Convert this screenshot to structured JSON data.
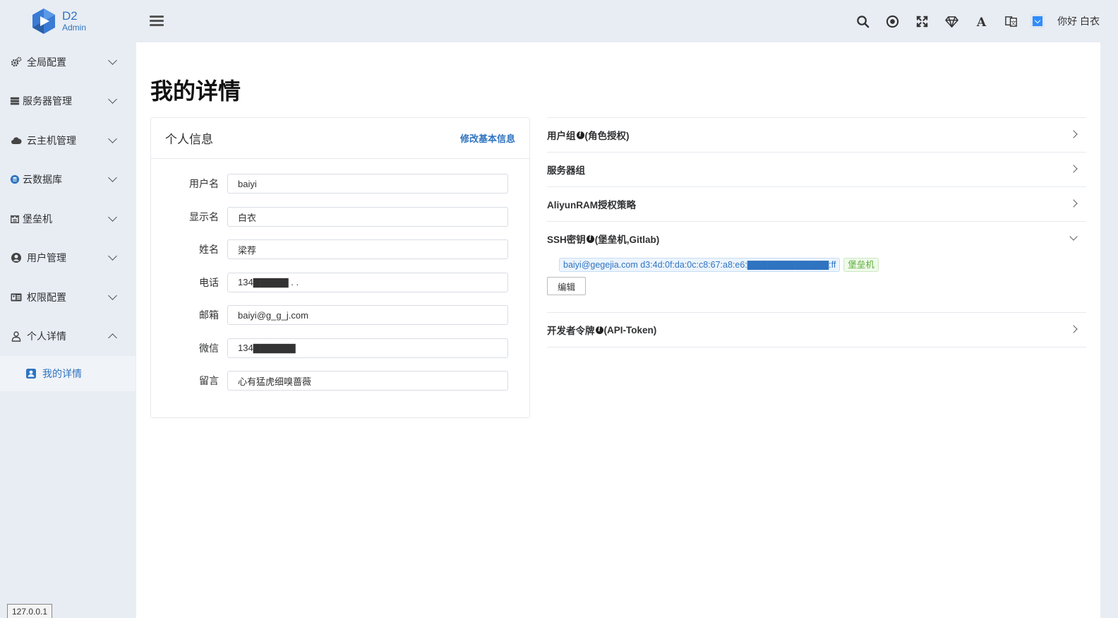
{
  "logo": {
    "title": "D2",
    "subtitle": "Admin"
  },
  "header": {
    "greeting": "你好 白衣",
    "accent": "#2f8cff"
  },
  "sidebar": {
    "items": [
      {
        "label": "全局配置",
        "icon": "gears-icon"
      },
      {
        "label": "服务器管理",
        "icon": "server-icon"
      },
      {
        "label": "云主机管理",
        "icon": "cloud-icon"
      },
      {
        "label": "云数据库",
        "icon": "database-icon"
      },
      {
        "label": "堡垒机",
        "icon": "fortress-icon"
      },
      {
        "label": "用户管理",
        "icon": "user-circle-icon"
      },
      {
        "label": "权限配置",
        "icon": "id-card-icon"
      },
      {
        "label": "个人详情",
        "icon": "user-outline-icon"
      }
    ],
    "sub_active": "我的详情",
    "ip": "127.0.0.1"
  },
  "page": {
    "title": "我的详情"
  },
  "profile": {
    "title": "个人信息",
    "edit_link": "修改基本信息",
    "fields": [
      {
        "label": "用户名",
        "value": "baiyi"
      },
      {
        "label": "显示名",
        "value": "白衣"
      },
      {
        "label": "姓名",
        "value": "梁荐"
      },
      {
        "label": "电话",
        "value": "134▇▇▇▇▇ . ."
      },
      {
        "label": "邮箱",
        "value": "baiyi@g_g_j.com"
      },
      {
        "label": "微信",
        "value": "134▇▇▇▇▇▇"
      },
      {
        "label": "留言",
        "value": "心有猛虎细嗅蔷薇"
      }
    ]
  },
  "panels": {
    "user_group": {
      "title": "用户组",
      "suffix": "(角色授权)"
    },
    "server_group": {
      "title": "服务器组"
    },
    "ram": {
      "title": "AliyunRAM授权策略"
    },
    "ssh": {
      "title": "SSH密钥",
      "suffix": "(堡垒机,Gitlab)",
      "key": "baiyi@gegejia.com d3:4d:0f:da:0c:c8:67:a8:e6:▇▇▇▇▇▇▇▇▇▇▇▇:ff",
      "tag": "堡垒机",
      "edit": "编辑"
    },
    "token": {
      "title": "开发者令牌",
      "suffix": "(API-Token)"
    }
  }
}
